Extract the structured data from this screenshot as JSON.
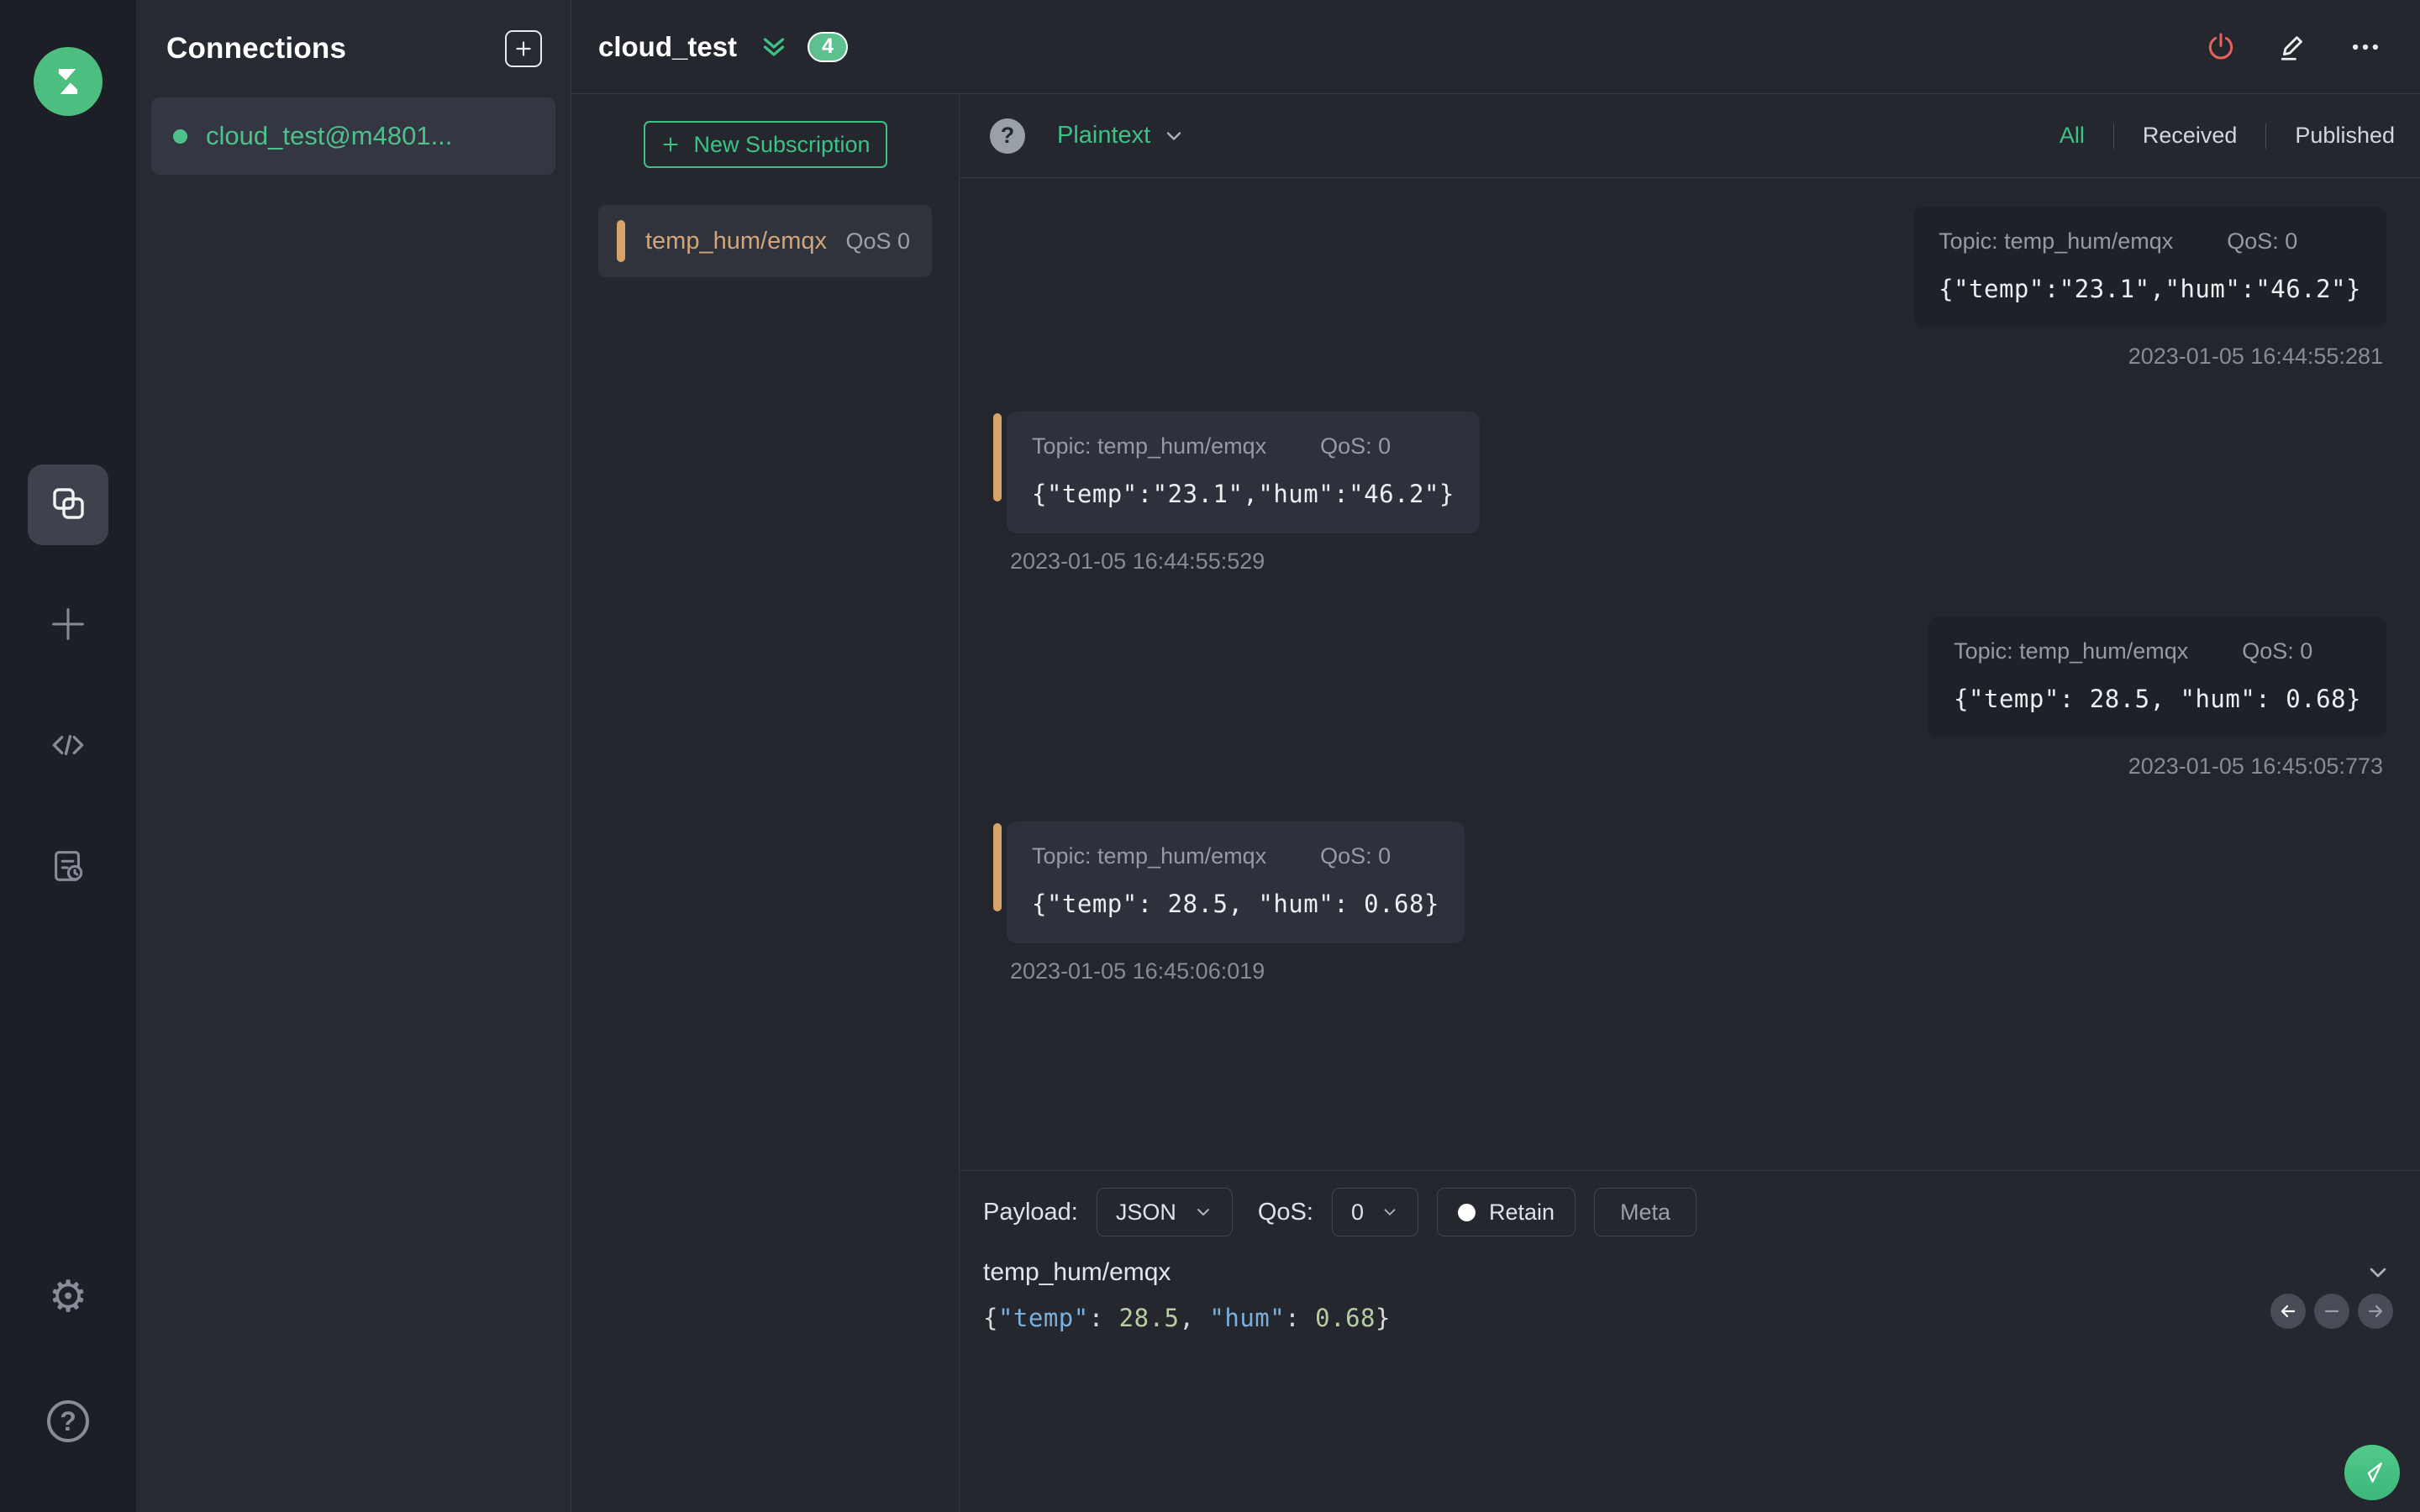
{
  "colors": {
    "accent_green": "#3ec184",
    "badge_green": "#5ec08f",
    "subscription_orange": "#d8a368",
    "disconnect_red": "#e4635e"
  },
  "sidebar": {
    "icons": [
      "mqttx-logo",
      "connections",
      "new-connection",
      "script",
      "log",
      "settings",
      "help"
    ],
    "help_glyph": "?",
    "settings_glyph": "⚙"
  },
  "connections_panel": {
    "title": "Connections",
    "items": [
      {
        "name": "cloud_test@m4801...",
        "status": "connected"
      }
    ]
  },
  "topbar": {
    "connection_title": "cloud_test",
    "badge_count": "4",
    "action_icons": [
      "disconnect-power",
      "edit-pencil",
      "more-options"
    ]
  },
  "subscriptions_panel": {
    "new_subscription_label": "New Subscription",
    "subscriptions": [
      {
        "topic": "temp_hum/emqx",
        "qos_label": "QoS 0"
      }
    ]
  },
  "messages_panel": {
    "help_glyph": "?",
    "payload_format": "Plaintext",
    "filters": [
      {
        "label": "All",
        "active": true
      },
      {
        "label": "Received",
        "active": false
      },
      {
        "label": "Published",
        "active": false
      }
    ],
    "messages": [
      {
        "direction": "published",
        "topic_label": "Topic: temp_hum/emqx",
        "qos_label": "QoS: 0",
        "payload": "{\"temp\":\"23.1\",\"hum\":\"46.2\"}",
        "timestamp": "2023-01-05 16:44:55:281"
      },
      {
        "direction": "received",
        "topic_label": "Topic: temp_hum/emqx",
        "qos_label": "QoS: 0",
        "payload": "{\"temp\":\"23.1\",\"hum\":\"46.2\"}",
        "timestamp": "2023-01-05 16:44:55:529"
      },
      {
        "direction": "published",
        "topic_label": "Topic: temp_hum/emqx",
        "qos_label": "QoS: 0",
        "payload": "{\"temp\": 28.5, \"hum\": 0.68}",
        "timestamp": "2023-01-05 16:45:05:773"
      },
      {
        "direction": "received",
        "topic_label": "Topic: temp_hum/emqx",
        "qos_label": "QoS: 0",
        "payload": "{\"temp\": 28.5, \"hum\": 0.68}",
        "timestamp": "2023-01-05 16:45:06:019"
      }
    ]
  },
  "publish_panel": {
    "payload_label": "Payload:",
    "payload_format_value": "JSON",
    "qos_label": "QoS:",
    "qos_value": "0",
    "retain_label": "Retain",
    "meta_label": "Meta",
    "topic_value": "temp_hum/emqx",
    "payload_tokens": [
      {
        "t": "{",
        "c": "punct"
      },
      {
        "t": "\"temp\"",
        "c": "key"
      },
      {
        "t": ": ",
        "c": "punct"
      },
      {
        "t": "28.5",
        "c": "num"
      },
      {
        "t": ", ",
        "c": "punct"
      },
      {
        "t": "\"hum\"",
        "c": "key"
      },
      {
        "t": ": ",
        "c": "punct"
      },
      {
        "t": "0.68",
        "c": "num"
      },
      {
        "t": "}",
        "c": "punct"
      }
    ]
  }
}
